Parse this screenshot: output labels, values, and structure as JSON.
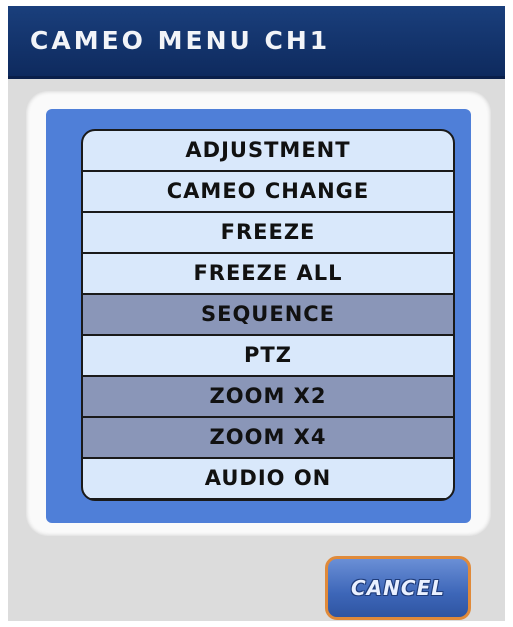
{
  "window": {
    "title": "CAMEO MENU CH1"
  },
  "menu": {
    "items": [
      {
        "label": "ADJUSTMENT",
        "enabled": true
      },
      {
        "label": "CAMEO CHANGE",
        "enabled": true
      },
      {
        "label": "FREEZE",
        "enabled": true
      },
      {
        "label": "FREEZE ALL",
        "enabled": true
      },
      {
        "label": "SEQUENCE",
        "enabled": false
      },
      {
        "label": "PTZ",
        "enabled": true
      },
      {
        "label": "ZOOM X2",
        "enabled": false
      },
      {
        "label": "ZOOM X4",
        "enabled": false
      },
      {
        "label": "AUDIO ON",
        "enabled": true
      }
    ]
  },
  "footer": {
    "cancel_label": "CANCEL"
  },
  "colors": {
    "titlebar": "#0e2a5e",
    "panel_accent": "#4f7fd8",
    "item_enabled": "#d9e8fb",
    "item_disabled": "#8a96b8",
    "cancel_border": "#e08a3a"
  }
}
